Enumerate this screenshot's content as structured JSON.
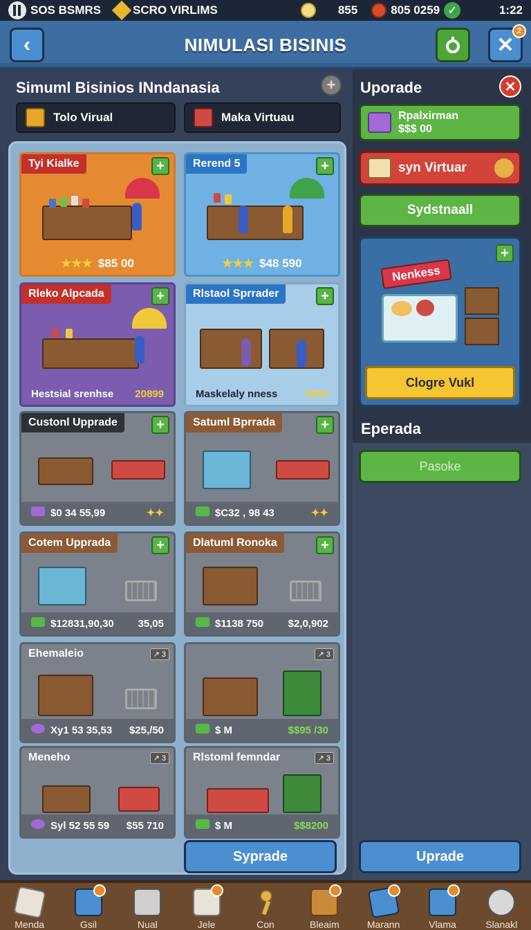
{
  "status": {
    "app1": "SOS BSMRS",
    "app2": "SCRO VIRLIMS",
    "coins": "855",
    "money": "805 0259",
    "time": "1:22"
  },
  "header": {
    "title": "NIMULASI BISINIS",
    "close_badge": "2"
  },
  "left": {
    "heading": "Simuml Bisinios INndanasia",
    "cat1": "Tolo Virual",
    "cat2": "Maka Virtuau",
    "cards": [
      {
        "title": "Tyi Kialke",
        "footer": "$85 00",
        "stars": "★★★"
      },
      {
        "title": "Rerend 5",
        "footer": "$48 590",
        "stars": "★★★"
      },
      {
        "title": "Rleko Alpcada",
        "footer_left": "Hestsial srenhse",
        "footer_right": "20899"
      },
      {
        "title": "Rlstaol Sprrader",
        "footer_left": "Maskelaly nness",
        "footer_right": "9959"
      },
      {
        "title": "Custonl Upprade",
        "footer_left": "$0 34 55,99",
        "footer_right": "✦✦"
      },
      {
        "title": "Satuml Bprrada",
        "footer_left": "$C32 , 98 43",
        "footer_right": "✦✦"
      },
      {
        "title": "Cotem Upprada",
        "footer_left": "$12831,90,30",
        "footer_right": "35,05"
      },
      {
        "title": "Dlatuml Ronoka",
        "footer_left": "$1138 750",
        "footer_right": "$2,0,902"
      },
      {
        "title": "Ehemaleio",
        "tag": "↗ 3",
        "footer_left": "Xy1 53 35,53",
        "footer_right": "$25,/50"
      },
      {
        "title": "",
        "tag": "↗ 3",
        "footer_left": "$ M",
        "footer_right": "$$95 /30"
      },
      {
        "title": "Meneho",
        "tag": "↗ 3",
        "footer_left": "Syl 52 55 59",
        "footer_right": "$55 710"
      },
      {
        "title": "Rlstoml femndar",
        "tag": "↗ 3",
        "footer_left": "$ M",
        "footer_right": "$$8200"
      }
    ],
    "bottom_button": "Syprade"
  },
  "right": {
    "heading": "Uporade",
    "btn1_line1": "Rpalxirman",
    "btn1_line2": "$$$ 00",
    "btn2": "syn Virtuar",
    "btn3": "Sydstnaall",
    "feature_sign": "Nenkess",
    "feature_button": "Clogre Vukl",
    "section2": "Eperada",
    "pasbtn": "Pasoke",
    "bottom_button": "Uprade"
  },
  "nav": [
    "Menda",
    "Gsil",
    "Nual",
    "Jele",
    "Con",
    "Bleaim",
    "Marann",
    "Vlama",
    "Slanakl"
  ],
  "colors": {
    "header_blue": "#3d6da1",
    "button_green": "#5db545",
    "button_red": "#d2433a",
    "gold": "#f5c532",
    "nav_brown": "#6b4a2e"
  }
}
